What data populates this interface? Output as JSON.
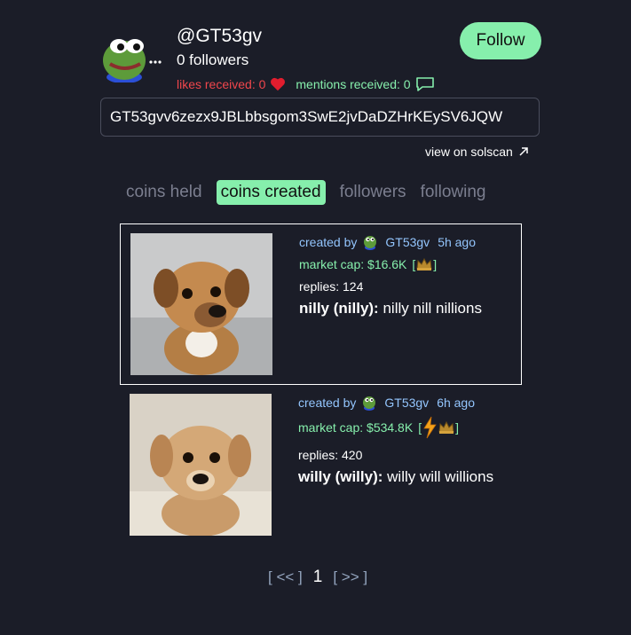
{
  "profile": {
    "username": "@GT53gv",
    "followers": "0 followers",
    "likes_received": "likes received: 0",
    "mentions_received": "mentions received: 0",
    "follow_label": "Follow",
    "address": "GT53gvv6zezx9JBLbbsgom3SwE2jvDaDZHrKEySV6JQW",
    "solscan_label": "view on solscan"
  },
  "tabs": [
    "coins held",
    "coins created",
    "followers",
    "following"
  ],
  "active_tab": "coins created",
  "coins": [
    {
      "created_by_label": "created by",
      "creator": "GT53gv",
      "time": "5h ago",
      "market_cap": "market cap: $16.6K",
      "replies": "replies: 124",
      "name": "nilly (nilly):",
      "description": "nilly nill nillions"
    },
    {
      "created_by_label": "created by",
      "creator": "GT53gv",
      "time": "6h ago",
      "market_cap": "market cap: $534.8K",
      "replies": "replies: 420",
      "name": "willy (willy):",
      "description": "willy will willions"
    }
  ],
  "pagination": {
    "prev": "[ << ]",
    "page": "1",
    "next": "[ >> ]"
  },
  "colors": {
    "background": "#1b1d28",
    "accent_green": "#86efac",
    "like_red": "#f0464c",
    "creator_blue": "#93c5fd"
  }
}
